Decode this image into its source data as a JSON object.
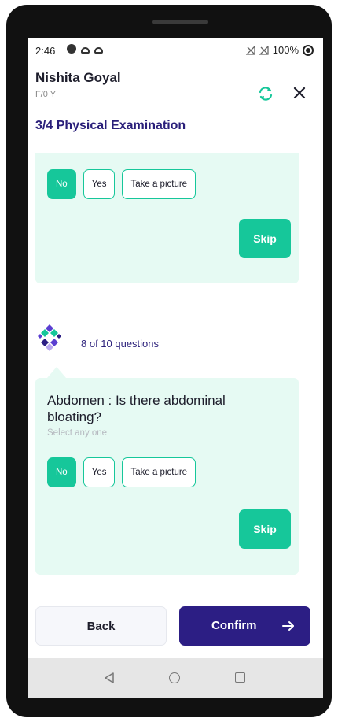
{
  "status_bar": {
    "time": "2:46",
    "battery": "100%"
  },
  "header": {
    "patient_name": "Nishita Goyal",
    "patient_meta": "F/0 Y",
    "section_title": "3/4 Physical Examination"
  },
  "previous_question": {
    "options": [
      {
        "label": "No",
        "selected": true
      },
      {
        "label": "Yes",
        "selected": false
      },
      {
        "label": "Take a picture",
        "selected": false
      }
    ],
    "skip_label": "Skip"
  },
  "progress": {
    "text": "8 of 10 questions"
  },
  "current_question": {
    "text": "Abdomen : Is there abdominal bloating?",
    "hint": "Select any one",
    "options": [
      {
        "label": "No",
        "selected": true
      },
      {
        "label": "Yes",
        "selected": false
      },
      {
        "label": "Take a picture",
        "selected": false
      }
    ],
    "skip_label": "Skip"
  },
  "footer": {
    "back_label": "Back",
    "confirm_label": "Confirm"
  },
  "colors": {
    "accent": "#16c79a",
    "primary": "#2c1e84",
    "card_bg": "#e6faf3"
  }
}
